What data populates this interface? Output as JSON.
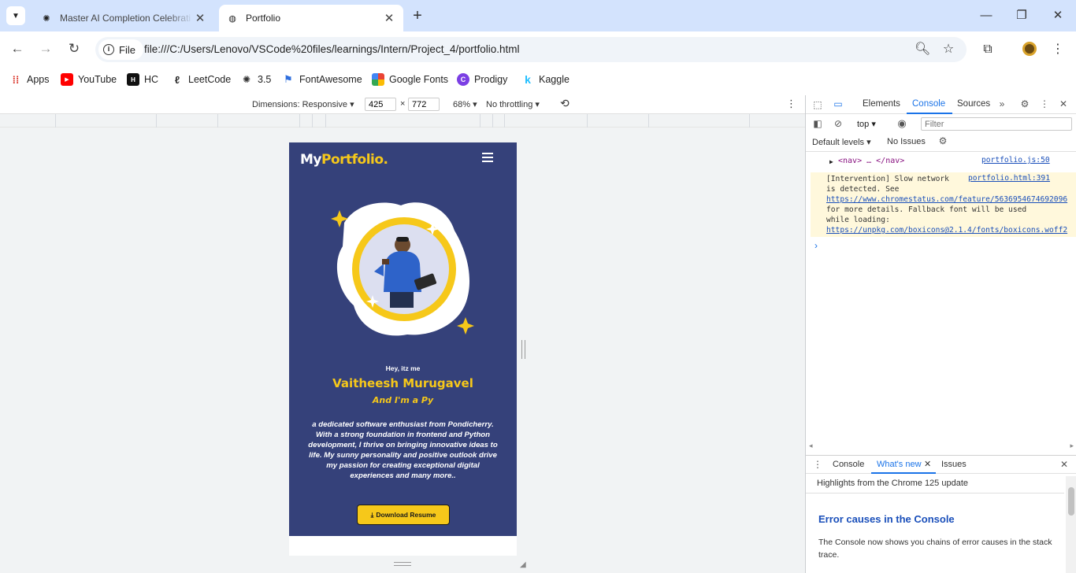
{
  "browser": {
    "tabs": [
      {
        "title": "Master AI Completion Celebrati",
        "active": false
      },
      {
        "title": "Portfolio",
        "active": true
      }
    ],
    "address": {
      "chip_label": "File",
      "url": "file:///C:/Users/Lenovo/VSCode%20files/learnings/Intern/Project_4/portfolio.html"
    },
    "bookmarks": [
      "Apps",
      "YouTube",
      "HC",
      "LeetCode",
      "3.5",
      "FontAwesome",
      "Google Fonts",
      "Prodigy",
      "Kaggle"
    ]
  },
  "device_toolbar": {
    "dimensions_label": "Dimensions: Responsive",
    "width": "425",
    "times": "×",
    "height": "772",
    "zoom": "68%",
    "throttling": "No throttling"
  },
  "site": {
    "logo_main": "My",
    "logo_accent": "Portfolio.",
    "greeting": "Hey, itz me",
    "name": "Vaitheesh Murugavel",
    "role": "And I'm a Py",
    "bio": "a dedicated software enthusiast from Pondicherry. With a strong foundation in frontend and Python development, I thrive on bringing innovative ideas to life. My sunny personality and positive outlook drive my passion for creating exceptional digital experiences and many more..",
    "download_label": "Download Resume"
  },
  "devtools": {
    "tabs": [
      "Elements",
      "Console",
      "Sources"
    ],
    "active_tab": "Console",
    "context": "top",
    "filter_placeholder": "Filter",
    "default_levels": "Default levels",
    "issues": "No Issues",
    "nav_line": {
      "text": "<nav> … </nav>",
      "source": "portfolio.js:50"
    },
    "warning": {
      "text": "[Intervention] Slow network\nis detected. See\n",
      "link1": "https://www.chromestatus.com/feature/5636954674692096",
      "middle": "\nfor more details. Fallback font will be used\nwhile loading:\n",
      "link2": "https://unpkg.com/boxicons@2.1.4/fonts/boxicons.woff2",
      "source": "portfolio.html:391"
    },
    "drawer_tabs": [
      "Console",
      "What's new",
      "Issues"
    ],
    "drawer_active": "What's new",
    "highlights": "Highlights from the Chrome 125 update",
    "news_title": "Error causes in the Console",
    "news_body": "The Console now shows you chains of error causes in the stack trace."
  }
}
